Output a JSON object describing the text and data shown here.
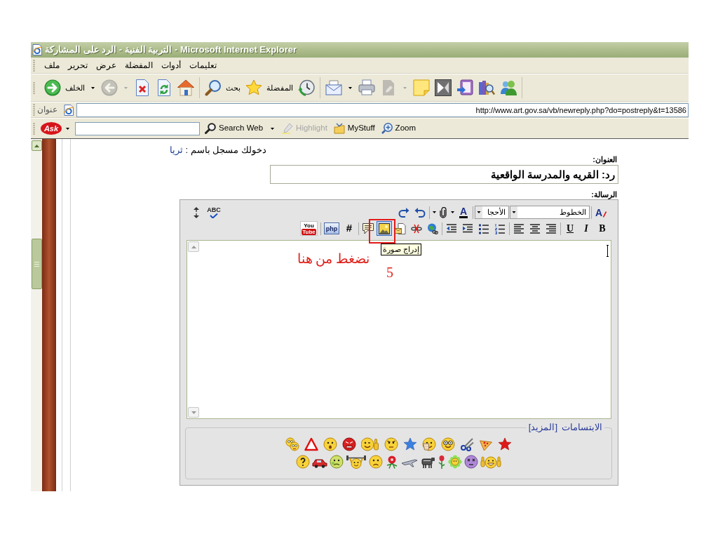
{
  "window": {
    "title": "التربية الفنية - الرد على المشاركة - Microsoft Internet Explorer"
  },
  "menu": [
    "تعليمات",
    "أدوات",
    "المفضلة",
    "عرض",
    "تحرير",
    "ملف"
  ],
  "toolbar": [
    [
      {
        "kind": "messenger",
        "disabled": false
      },
      {
        "kind": "research",
        "disabled": false
      },
      {
        "kind": "onenote",
        "disabled": false
      },
      {
        "kind": "app",
        "disabled": false
      },
      {
        "kind": "note",
        "disabled": false
      },
      {
        "kind": "edit",
        "disabled": true
      },
      {
        "kind": "print",
        "disabled": false
      },
      {
        "kind": "mail",
        "disabled": false
      }
    ],
    [
      {
        "kind": "history",
        "disabled": false
      },
      {
        "kind": "favorites",
        "label": "المفضلة",
        "disabled": false
      },
      {
        "kind": "search",
        "label": "بحث",
        "disabled": false
      }
    ],
    [
      {
        "kind": "home",
        "disabled": false
      },
      {
        "kind": "refresh",
        "disabled": false
      },
      {
        "kind": "stop",
        "disabled": false
      },
      {
        "kind": "forward",
        "disabled": true
      },
      {
        "kind": "back",
        "label": "الخلف",
        "disabled": false
      }
    ]
  ],
  "address_bar": {
    "label": "عنوان",
    "url": "http://www.art.gov.sa/vb/newreply.php?do=postreply&t=13586"
  },
  "ask_toolbar": {
    "logo": "Ask",
    "tools": [
      {
        "kind": "zoom",
        "label": "Zoom",
        "disabled": false
      },
      {
        "kind": "mystuff",
        "label": "MyStuff",
        "disabled": false
      },
      {
        "kind": "highlight",
        "label": "Highlight",
        "disabled": true
      },
      {
        "kind": "search",
        "label": "Search Web",
        "disabled": false
      }
    ]
  },
  "page": {
    "login_text": "دخولك مسجل باسم :",
    "username": "ثريا",
    "title_label": "العنوان:",
    "title_value": "رد: القريه والمدرسة الواقعية",
    "message_label": "الرسالة:"
  },
  "editor": {
    "tools_row1": [
      [
        {
          "kind": "remove_format",
          "text": "A",
          "highlighted": false
        }
      ],
      [
        {
          "kind": "font_select",
          "text": "الخطوط",
          "highlighted": false
        },
        {
          "kind": "size_select",
          "text": "الأحجا",
          "highlighted": false
        }
      ],
      [
        {
          "kind": "font_color",
          "text": "A",
          "highlighted": false
        },
        {
          "kind": "attach",
          "highlighted": false
        }
      ],
      [
        {
          "kind": "undo",
          "highlighted": false
        },
        {
          "kind": "redo",
          "highlighted": false
        }
      ]
    ],
    "tools_row1_end": [
      {
        "kind": "spellcheck",
        "text": "ABC"
      },
      {
        "kind": "resize"
      }
    ],
    "tools_row2": [
      [
        {
          "kind": "bold",
          "text": "B",
          "highlighted": false
        },
        {
          "kind": "italic",
          "text": "I",
          "highlighted": false
        },
        {
          "kind": "underline",
          "text": "U",
          "highlighted": false
        }
      ],
      [
        {
          "kind": "align_right",
          "highlighted": false
        },
        {
          "kind": "align_center",
          "highlighted": false
        },
        {
          "kind": "align_left",
          "highlighted": false
        }
      ],
      [
        {
          "kind": "ordered_list",
          "highlighted": false
        },
        {
          "kind": "unordered_list",
          "highlighted": false
        },
        {
          "kind": "indent",
          "highlighted": false
        },
        {
          "kind": "outdent",
          "highlighted": false
        }
      ],
      [
        {
          "kind": "link",
          "highlighted": false
        },
        {
          "kind": "unlink",
          "highlighted": false
        },
        {
          "kind": "email",
          "highlighted": false
        },
        {
          "kind": "image",
          "highlighted": true
        },
        {
          "kind": "quote",
          "highlighted": false
        }
      ],
      [
        {
          "kind": "hash",
          "text": "#",
          "highlighted": false
        },
        {
          "kind": "php",
          "text": "php",
          "highlighted": false
        }
      ],
      [
        {
          "kind": "youtube",
          "text": "You",
          "text2": "Tube",
          "highlighted": false
        }
      ]
    ],
    "tooltip": "إدراج صورة"
  },
  "annotation": {
    "text": "نضغط من هنا",
    "step": "5"
  },
  "smilies": {
    "legend": "الابتسامات",
    "more": "[المزيد]"
  }
}
